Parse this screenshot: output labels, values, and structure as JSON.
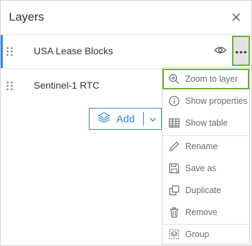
{
  "header": {
    "title": "Layers",
    "close_icon": "close-icon"
  },
  "layers": [
    {
      "name": "USA Lease Blocks",
      "selected": true
    },
    {
      "name": "Sentinel-1 RTC",
      "selected": false
    }
  ],
  "add_button": {
    "label": "Add"
  },
  "context_menu": {
    "items": [
      {
        "label": "Zoom to layer",
        "icon": "zoom-in-icon"
      },
      {
        "label": "Show properties",
        "icon": "info-icon"
      },
      {
        "label": "Show table",
        "icon": "table-icon"
      },
      {
        "label": "Rename",
        "icon": "pencil-icon"
      },
      {
        "label": "Save as",
        "icon": "save-icon"
      },
      {
        "label": "Duplicate",
        "icon": "duplicate-icon"
      },
      {
        "label": "Remove",
        "icon": "trash-icon"
      },
      {
        "label": "Group",
        "icon": "group-icon"
      }
    ]
  },
  "colors": {
    "accent": "#2f84d4",
    "highlight": "#6ab02d",
    "menu_text": "#6a6a6a"
  }
}
